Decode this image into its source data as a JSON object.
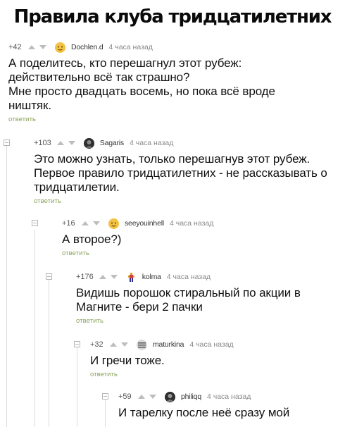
{
  "title": "Правила клуба тридцатилетних",
  "comments": [
    {
      "rating": "+42",
      "author": "Dochlen.d",
      "time": "4 часа назад",
      "avatar": "yellow-face-icon",
      "text": "А поделитесь, кто перешагнул этот рубеж: действительно всё так страшно?\nМне просто двадцать восемь, но пока всё вроде ништяк.",
      "reply": "ответить"
    },
    {
      "rating": "+103",
      "author": "Sagaris",
      "time": "4 часа назад",
      "avatar": "dark-avatar-icon",
      "text": "Это можно узнать, только перешагнув этот рубеж. Первое правило тридцатилетних - не рассказывать о тридцатилетии.",
      "reply": "ответить"
    },
    {
      "rating": "+16",
      "author": "seeyouinhell",
      "time": "4 часа назад",
      "avatar": "yellow-face-icon",
      "text": "А второе?)",
      "reply": "ответить"
    },
    {
      "rating": "+176",
      "author": "kolma",
      "time": "4 часа назад",
      "avatar": "pixel-figure-icon",
      "text": "Видишь порошок стиральный по акции в Магните - бери 2 пачки",
      "reply": "ответить"
    },
    {
      "rating": "+32",
      "author": "maturkina",
      "time": "4 часа назад",
      "avatar": "striped-avatar-icon",
      "text": "И гречи тоже.",
      "reply": "ответить"
    },
    {
      "rating": "+59",
      "author": "philiqq",
      "time": "4 часа назад",
      "avatar": "dark-avatar-icon",
      "text": "И тарелку после неё сразу мой",
      "reply": ""
    }
  ],
  "colors": {
    "reply": "#8aa35a",
    "thread_line": "#dcdcdc"
  }
}
